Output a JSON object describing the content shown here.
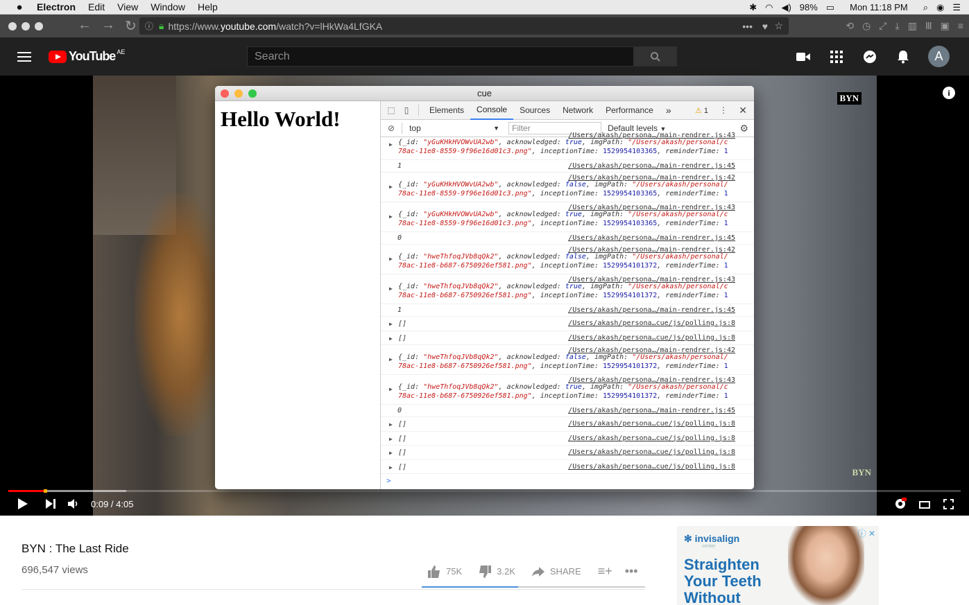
{
  "menubar": {
    "app_name": "Electron",
    "menus": [
      "Edit",
      "View",
      "Window",
      "Help"
    ],
    "battery": "98%",
    "clock": "Mon 11:18 PM"
  },
  "browser": {
    "url_prefix": "https://www.",
    "url_host": "youtube.com",
    "url_path": "/watch?v=lHkWa4LfGKA"
  },
  "youtube": {
    "logo_text": "YouTube",
    "country_code": "AE",
    "search_placeholder": "Search",
    "avatar_letter": "A"
  },
  "player": {
    "watermark": "BYN",
    "time": "0:09 / 4:05",
    "progress": 0.037
  },
  "electron_window": {
    "title": "cue",
    "heading": "Hello World!"
  },
  "devtools": {
    "tabs": [
      "Elements",
      "Console",
      "Sources",
      "Network",
      "Performance"
    ],
    "active_tab": "Console",
    "more": "»",
    "warnings": "1",
    "context": "top",
    "filter_placeholder": "Filter",
    "levels": "Default levels",
    "prompt": ">",
    "logs": [
      {
        "type": "obj",
        "id": "yGuKHkHVOWvUA2wb",
        "ack": "true",
        "path": "\"/Users/akash/personal/c",
        "file": "78ac-11e8-8559-9f96e16d01c3.png\"",
        "time": "1529954103365",
        "src": "/Users/akash/persona…/main-rendrer.js:43"
      },
      {
        "type": "num",
        "value": "1",
        "src": "/Users/akash/persona…/main-rendrer.js:45"
      },
      {
        "type": "obj",
        "id": "yGuKHkHVOWvUA2wb",
        "ack": "false",
        "path": "\"/Users/akash/personal/",
        "file": "78ac-11e8-8559-9f96e16d01c3.png\"",
        "time": "1529954103365",
        "src": "/Users/akash/persona…/main-rendrer.js:42"
      },
      {
        "type": "obj",
        "id": "yGuKHkHVOWvUA2wb",
        "ack": "true",
        "path": "\"/Users/akash/personal/c",
        "file": "78ac-11e8-8559-9f96e16d01c3.png\"",
        "time": "1529954103365",
        "src": "/Users/akash/persona…/main-rendrer.js:43"
      },
      {
        "type": "num",
        "value": "0",
        "src": "/Users/akash/persona…/main-rendrer.js:45"
      },
      {
        "type": "obj",
        "id": "hweThfoqJVb8qQk2",
        "ack": "false",
        "path": "\"/Users/akash/personal/",
        "file": "78ac-11e8-b687-6750926ef581.png\"",
        "time": "1529954101372",
        "src": "/Users/akash/persona…/main-rendrer.js:42"
      },
      {
        "type": "obj",
        "id": "hweThfoqJVb8qQk2",
        "ack": "true",
        "path": "\"/Users/akash/personal/c",
        "file": "78ac-11e8-b687-6750926ef581.png\"",
        "time": "1529954101372",
        "src": "/Users/akash/persona…/main-rendrer.js:43"
      },
      {
        "type": "num",
        "value": "1",
        "src": "/Users/akash/persona…/main-rendrer.js:45"
      },
      {
        "type": "arr",
        "value": "[]",
        "src": "/Users/akash/persona…cue/js/polling.js:8"
      },
      {
        "type": "arr",
        "value": "[]",
        "src": "/Users/akash/persona…cue/js/polling.js:8"
      },
      {
        "type": "obj",
        "id": "hweThfoqJVb8qQk2",
        "ack": "false",
        "path": "\"/Users/akash/personal/",
        "file": "78ac-11e8-b687-6750926ef581.png\"",
        "time": "1529954101372",
        "src": "/Users/akash/persona…/main-rendrer.js:42"
      },
      {
        "type": "obj",
        "id": "hweThfoqJVb8qQk2",
        "ack": "true",
        "path": "\"/Users/akash/personal/c",
        "file": "78ac-11e8-b687-6750926ef581.png\"",
        "time": "1529954101372",
        "src": "/Users/akash/persona…/main-rendrer.js:43"
      },
      {
        "type": "num",
        "value": "0",
        "src": "/Users/akash/persona…/main-rendrer.js:45"
      },
      {
        "type": "arr",
        "value": "[]",
        "src": "/Users/akash/persona…cue/js/polling.js:8"
      },
      {
        "type": "arr",
        "value": "[]",
        "src": "/Users/akash/persona…cue/js/polling.js:8"
      },
      {
        "type": "arr",
        "value": "[]",
        "src": "/Users/akash/persona…cue/js/polling.js:8"
      },
      {
        "type": "arr",
        "value": "[]",
        "src": "/Users/akash/persona…cue/js/polling.js:8"
      }
    ]
  },
  "video_info": {
    "title": "BYN : The Last Ride",
    "views": "696,547 views",
    "likes": "75K",
    "dislikes": "3.2K",
    "share": "SHARE",
    "like_ratio": 0.96
  },
  "ad": {
    "brand": "invisalign",
    "brand_sub": "center",
    "headline": "Straighten Your Teeth Without"
  }
}
